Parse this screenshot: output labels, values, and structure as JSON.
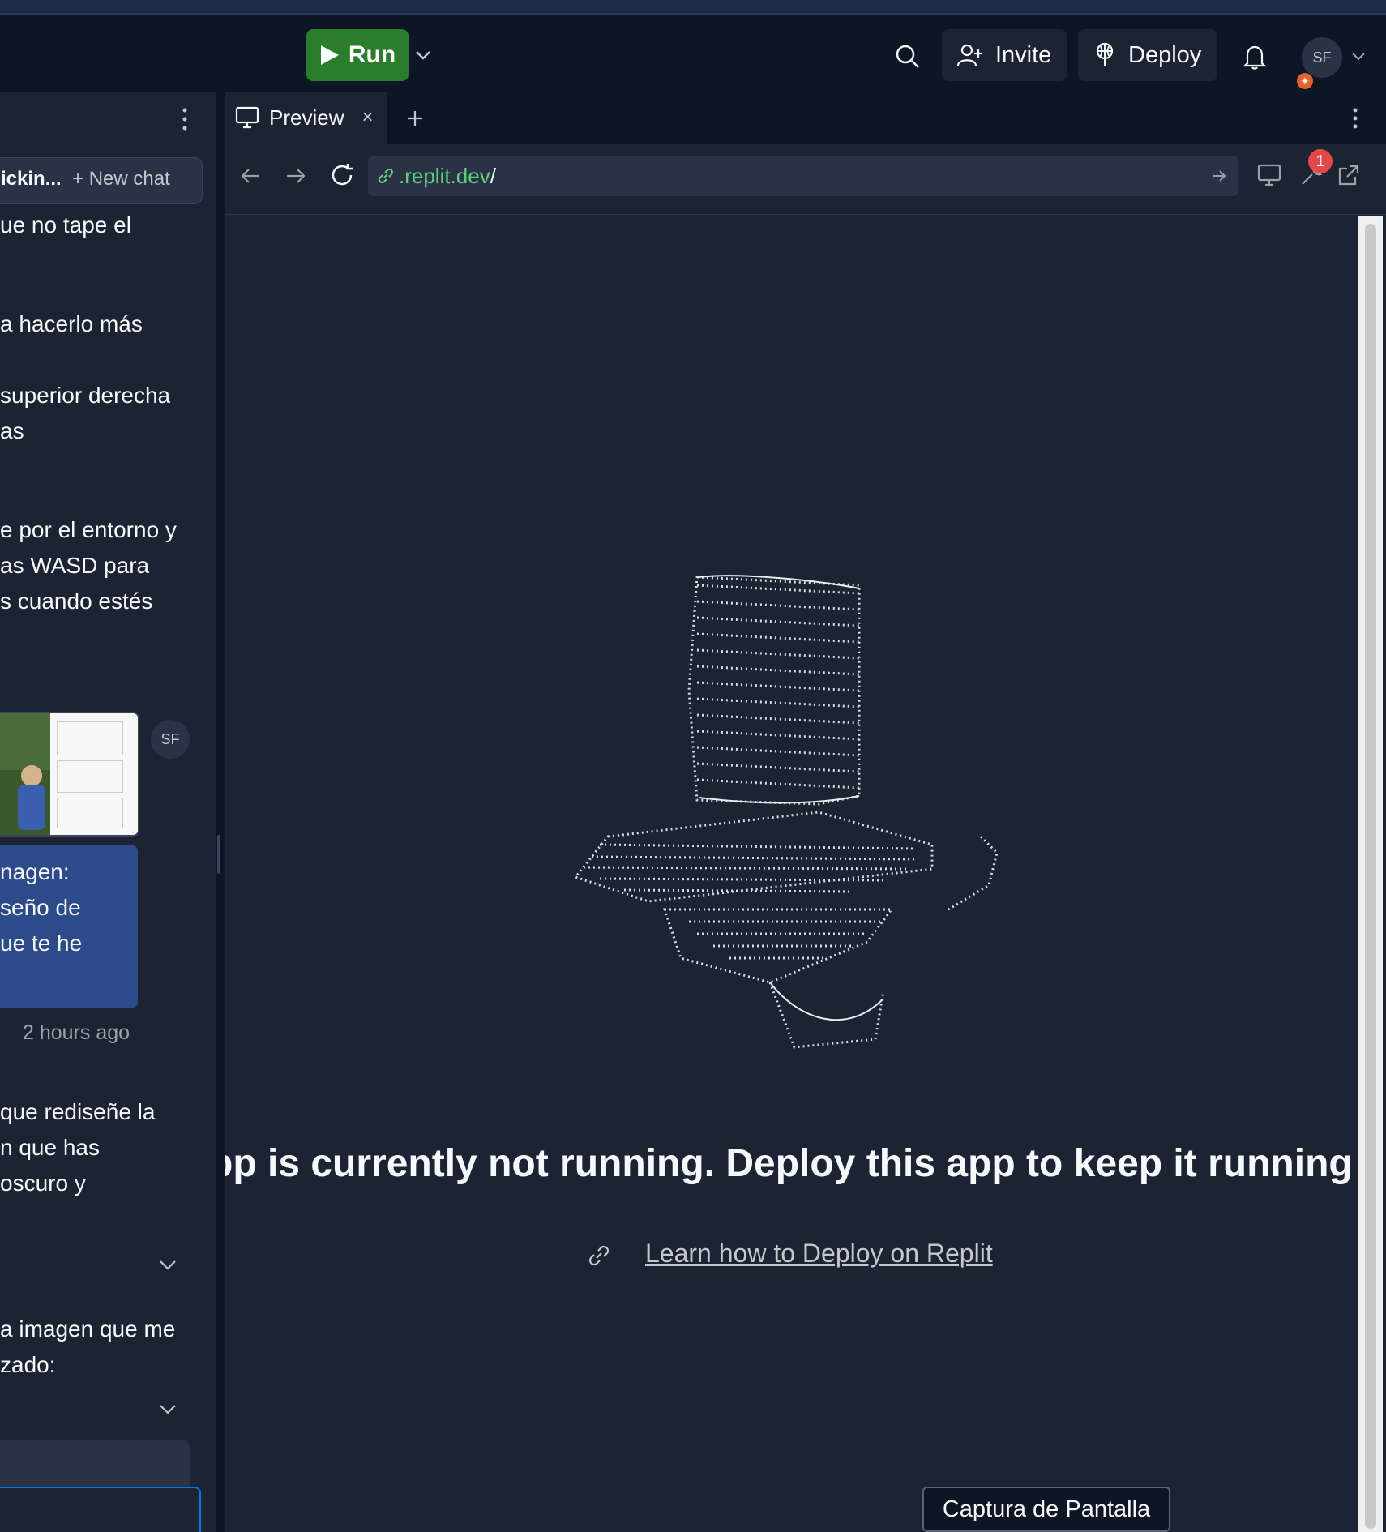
{
  "topbar": {
    "run_label": "Run",
    "invite_label": "Invite",
    "deploy_label": "Deploy",
    "avatar_initials": "SF"
  },
  "chat": {
    "title": "ickin...",
    "new_chat_label": "New chat",
    "messages_top": [
      "ue no tape el",
      "a hacerlo más",
      "superior derecha",
      "as",
      "e por el entorno y",
      "as WASD para",
      "s cuando estés"
    ],
    "user_avatar": "SF",
    "user_message_lines": [
      "nagen:",
      "seño de",
      "ue te he"
    ],
    "timestamp": "2 hours ago",
    "messages_bottom": [
      "que rediseñe la",
      "n que has",
      "oscuro y"
    ],
    "messages_last": [
      "a imagen que me",
      "zado:"
    ]
  },
  "preview": {
    "tab_label": "Preview",
    "url_host": ".replit.dev",
    "url_path": "/",
    "warning_badge": "1",
    "not_running_text": "pp is currently not running. Deploy this app to keep it running exte",
    "learn_link": "Learn how to Deploy on Replit"
  },
  "tooltip": "Captura de Pantalla",
  "colors": {
    "run_green": "#2a7d2a",
    "url_green": "#5dd17a",
    "user_bubble": "#2d4a8a",
    "badge_red": "#e54848"
  }
}
